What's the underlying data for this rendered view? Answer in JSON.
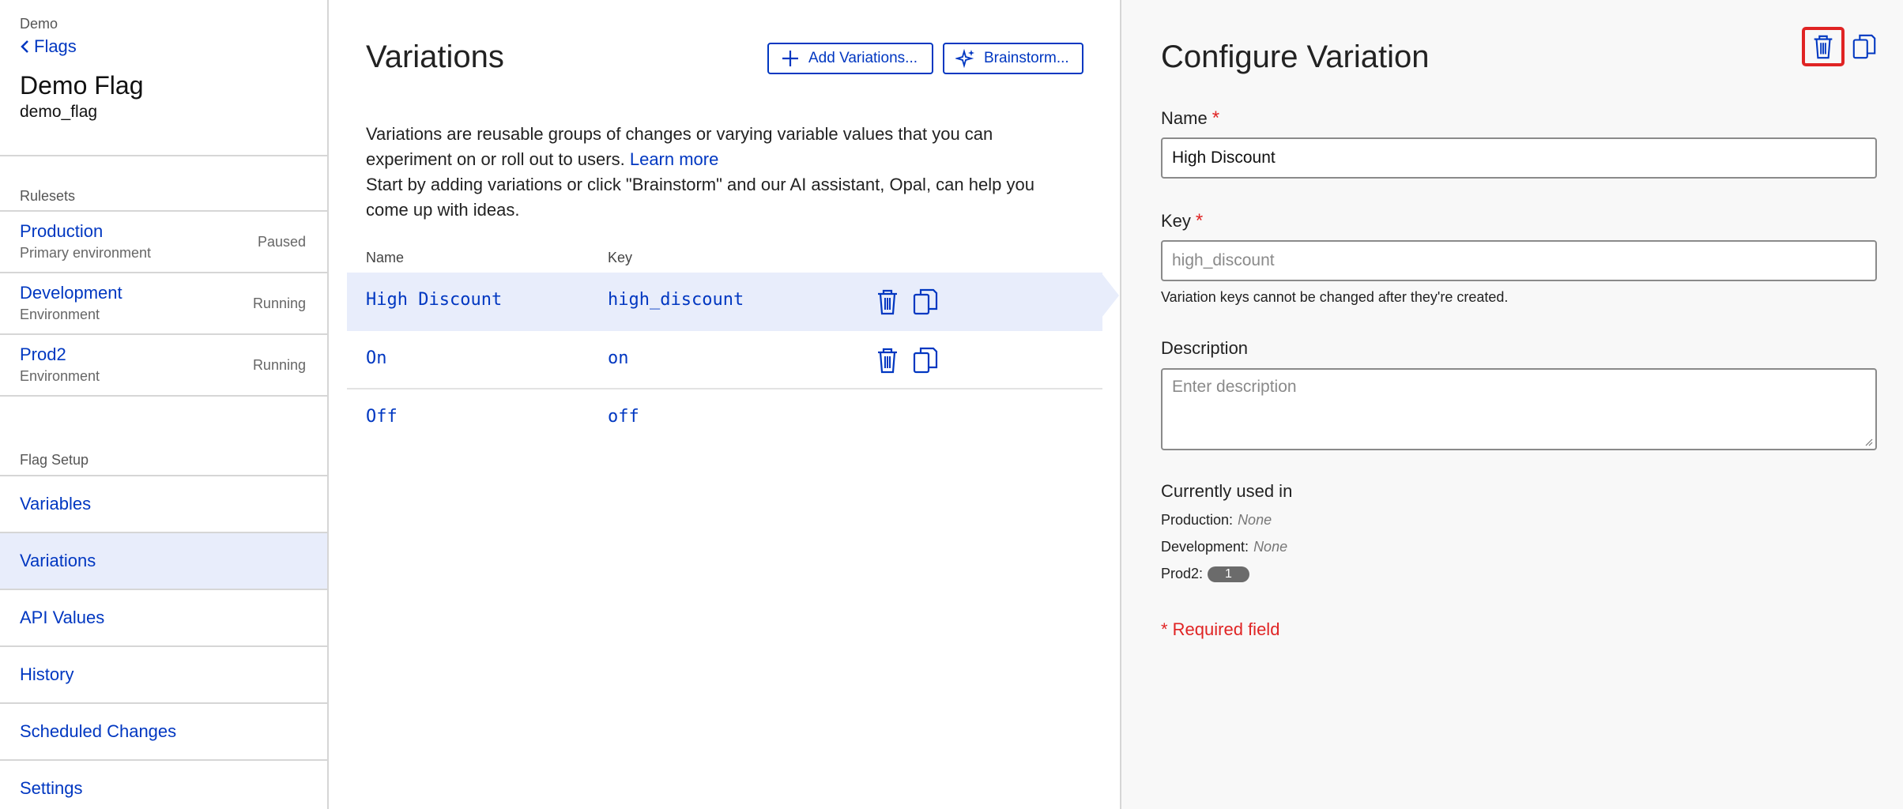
{
  "sidebar": {
    "breadcrumb": "Demo",
    "back_label": "Flags",
    "flag_title": "Demo Flag",
    "flag_key": "demo_flag",
    "rulesets_label": "Rulesets",
    "rulesets": [
      {
        "name": "Production",
        "sub": "Primary environment",
        "status": "Paused"
      },
      {
        "name": "Development",
        "sub": "Environment",
        "status": "Running"
      },
      {
        "name": "Prod2",
        "sub": "Environment",
        "status": "Running"
      }
    ],
    "setup_label": "Flag Setup",
    "nav": [
      {
        "label": "Variables"
      },
      {
        "label": "Variations"
      },
      {
        "label": "API Values"
      },
      {
        "label": "History"
      },
      {
        "label": "Scheduled Changes"
      },
      {
        "label": "Settings"
      }
    ],
    "active_nav": "Variations"
  },
  "main": {
    "title": "Variations",
    "add_button": "Add Variations...",
    "brainstorm_button": "Brainstorm...",
    "desc_line1": "Variations are reusable groups of changes or varying variable values that you can experiment on or roll out to users.",
    "learn_more": "Learn more",
    "desc_line2": "Start by adding variations or click \"Brainstorm\" and our AI assistant, Opal, can help you come up with ideas.",
    "columns": {
      "name": "Name",
      "key": "Key"
    },
    "rows": [
      {
        "name": "High Discount",
        "key": "high_discount"
      },
      {
        "name": "On",
        "key": "on"
      },
      {
        "name": "Off",
        "key": "off"
      }
    ]
  },
  "panel": {
    "title": "Configure Variation",
    "name_label": "Name",
    "required_mark": "*",
    "name_value": "High Discount",
    "key_label": "Key",
    "key_value": "high_discount",
    "key_hint": "Variation keys cannot be changed after they're created.",
    "description_label": "Description",
    "description_placeholder": "Enter description",
    "used_title": "Currently used in",
    "used": [
      {
        "env": "Production:",
        "value": "None"
      },
      {
        "env": "Development:",
        "value": "None"
      },
      {
        "env": "Prod2:",
        "badge": "1"
      }
    ],
    "required_note": "* Required field"
  },
  "icons": {
    "delete": "trash-icon",
    "copy": "copy-icon",
    "add": "plus-icon",
    "brainstorm": "sparkle-icon",
    "back": "chevron-left-icon"
  },
  "colors": {
    "accent": "#0037c1",
    "selected_row": "#e8edfb",
    "required": "#e02424",
    "highlight_border": "#e02424"
  }
}
